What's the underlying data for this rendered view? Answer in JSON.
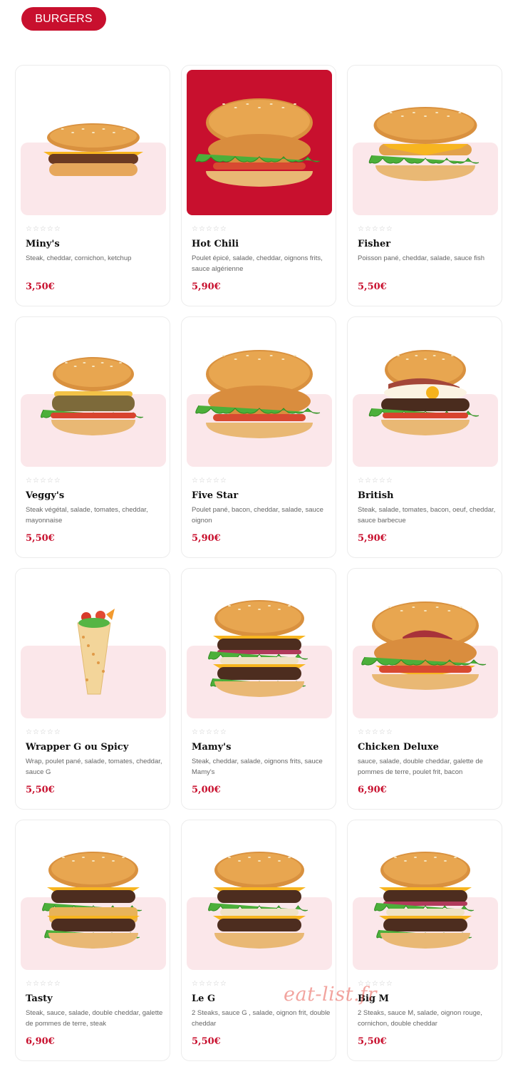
{
  "category": {
    "label": "BURGERS"
  },
  "rating_stars": "☆☆☆☆☆",
  "items": [
    {
      "name": "Miny's",
      "desc": "Steak, cheddar, cornichon, ketchup",
      "price": "3,50€",
      "icon": "cheeseburger-icon",
      "highlight": false,
      "style": "mini"
    },
    {
      "name": "Hot Chili",
      "desc": "Poulet épicé, salade, cheddar, oignons frits, sauce algérienne",
      "price": "5,90€",
      "icon": "chicken-burger-icon",
      "highlight": true,
      "style": "chicken"
    },
    {
      "name": "Fisher",
      "desc": "Poisson pané, cheddar, salade, sauce fish",
      "price": "5,50€",
      "icon": "fish-burger-icon",
      "highlight": false,
      "style": "fish"
    },
    {
      "name": "Veggy's",
      "desc": "Steak végétal, salade, tomates, cheddar, mayonnaise",
      "price": "5,50€",
      "icon": "veggie-burger-icon",
      "highlight": false,
      "style": "veggie"
    },
    {
      "name": "Five Star",
      "desc": "Poulet pané, bacon, cheddar, salade, sauce oignon",
      "price": "5,90€",
      "icon": "chicken-burger-icon",
      "highlight": false,
      "style": "chicken"
    },
    {
      "name": "British",
      "desc": "Steak, salade, tomates, bacon, oeuf, cheddar, sauce barbecue",
      "price": "5,90€",
      "icon": "egg-burger-icon",
      "highlight": false,
      "style": "british"
    },
    {
      "name": "Wrapper G ou Spicy",
      "desc": "Wrap, poulet pané, salade, tomates, cheddar, sauce G",
      "price": "5,50€",
      "icon": "wrap-icon",
      "highlight": false,
      "style": "wrap"
    },
    {
      "name": "Mamy's",
      "desc": "Steak, cheddar, salade, oignons frits, sauce Mamy's",
      "price": "5,00€",
      "icon": "double-burger-icon",
      "highlight": false,
      "style": "double"
    },
    {
      "name": "Chicken Deluxe",
      "desc": "sauce, salade, double cheddar, galette de pommes de terre, poulet frit, bacon",
      "price": "6,90€",
      "icon": "chicken-burger-icon",
      "highlight": false,
      "style": "deluxe"
    },
    {
      "name": "Tasty",
      "desc": "Steak, sauce, salade, double cheddar, galette de pommes de terre, steak",
      "price": "6,90€",
      "icon": "double-burger-icon",
      "highlight": false,
      "style": "tasty"
    },
    {
      "name": "Le G",
      "desc": "2 Steaks, sauce G , salade, oignon frit, double cheddar",
      "price": "5,50€",
      "icon": "double-burger-icon",
      "highlight": false,
      "style": "leg"
    },
    {
      "name": "Big M",
      "desc": "2 Steaks, sauce M, salade, oignon rouge, cornichon, double cheddar",
      "price": "5,50€",
      "icon": "big-burger-icon",
      "highlight": false,
      "style": "bigm"
    }
  ],
  "watermark": "eat-list.fr",
  "colors": {
    "accent": "#c8102e",
    "card_bg_tint": "#fbe7ea",
    "text": "#111111",
    "muted": "#666666"
  }
}
